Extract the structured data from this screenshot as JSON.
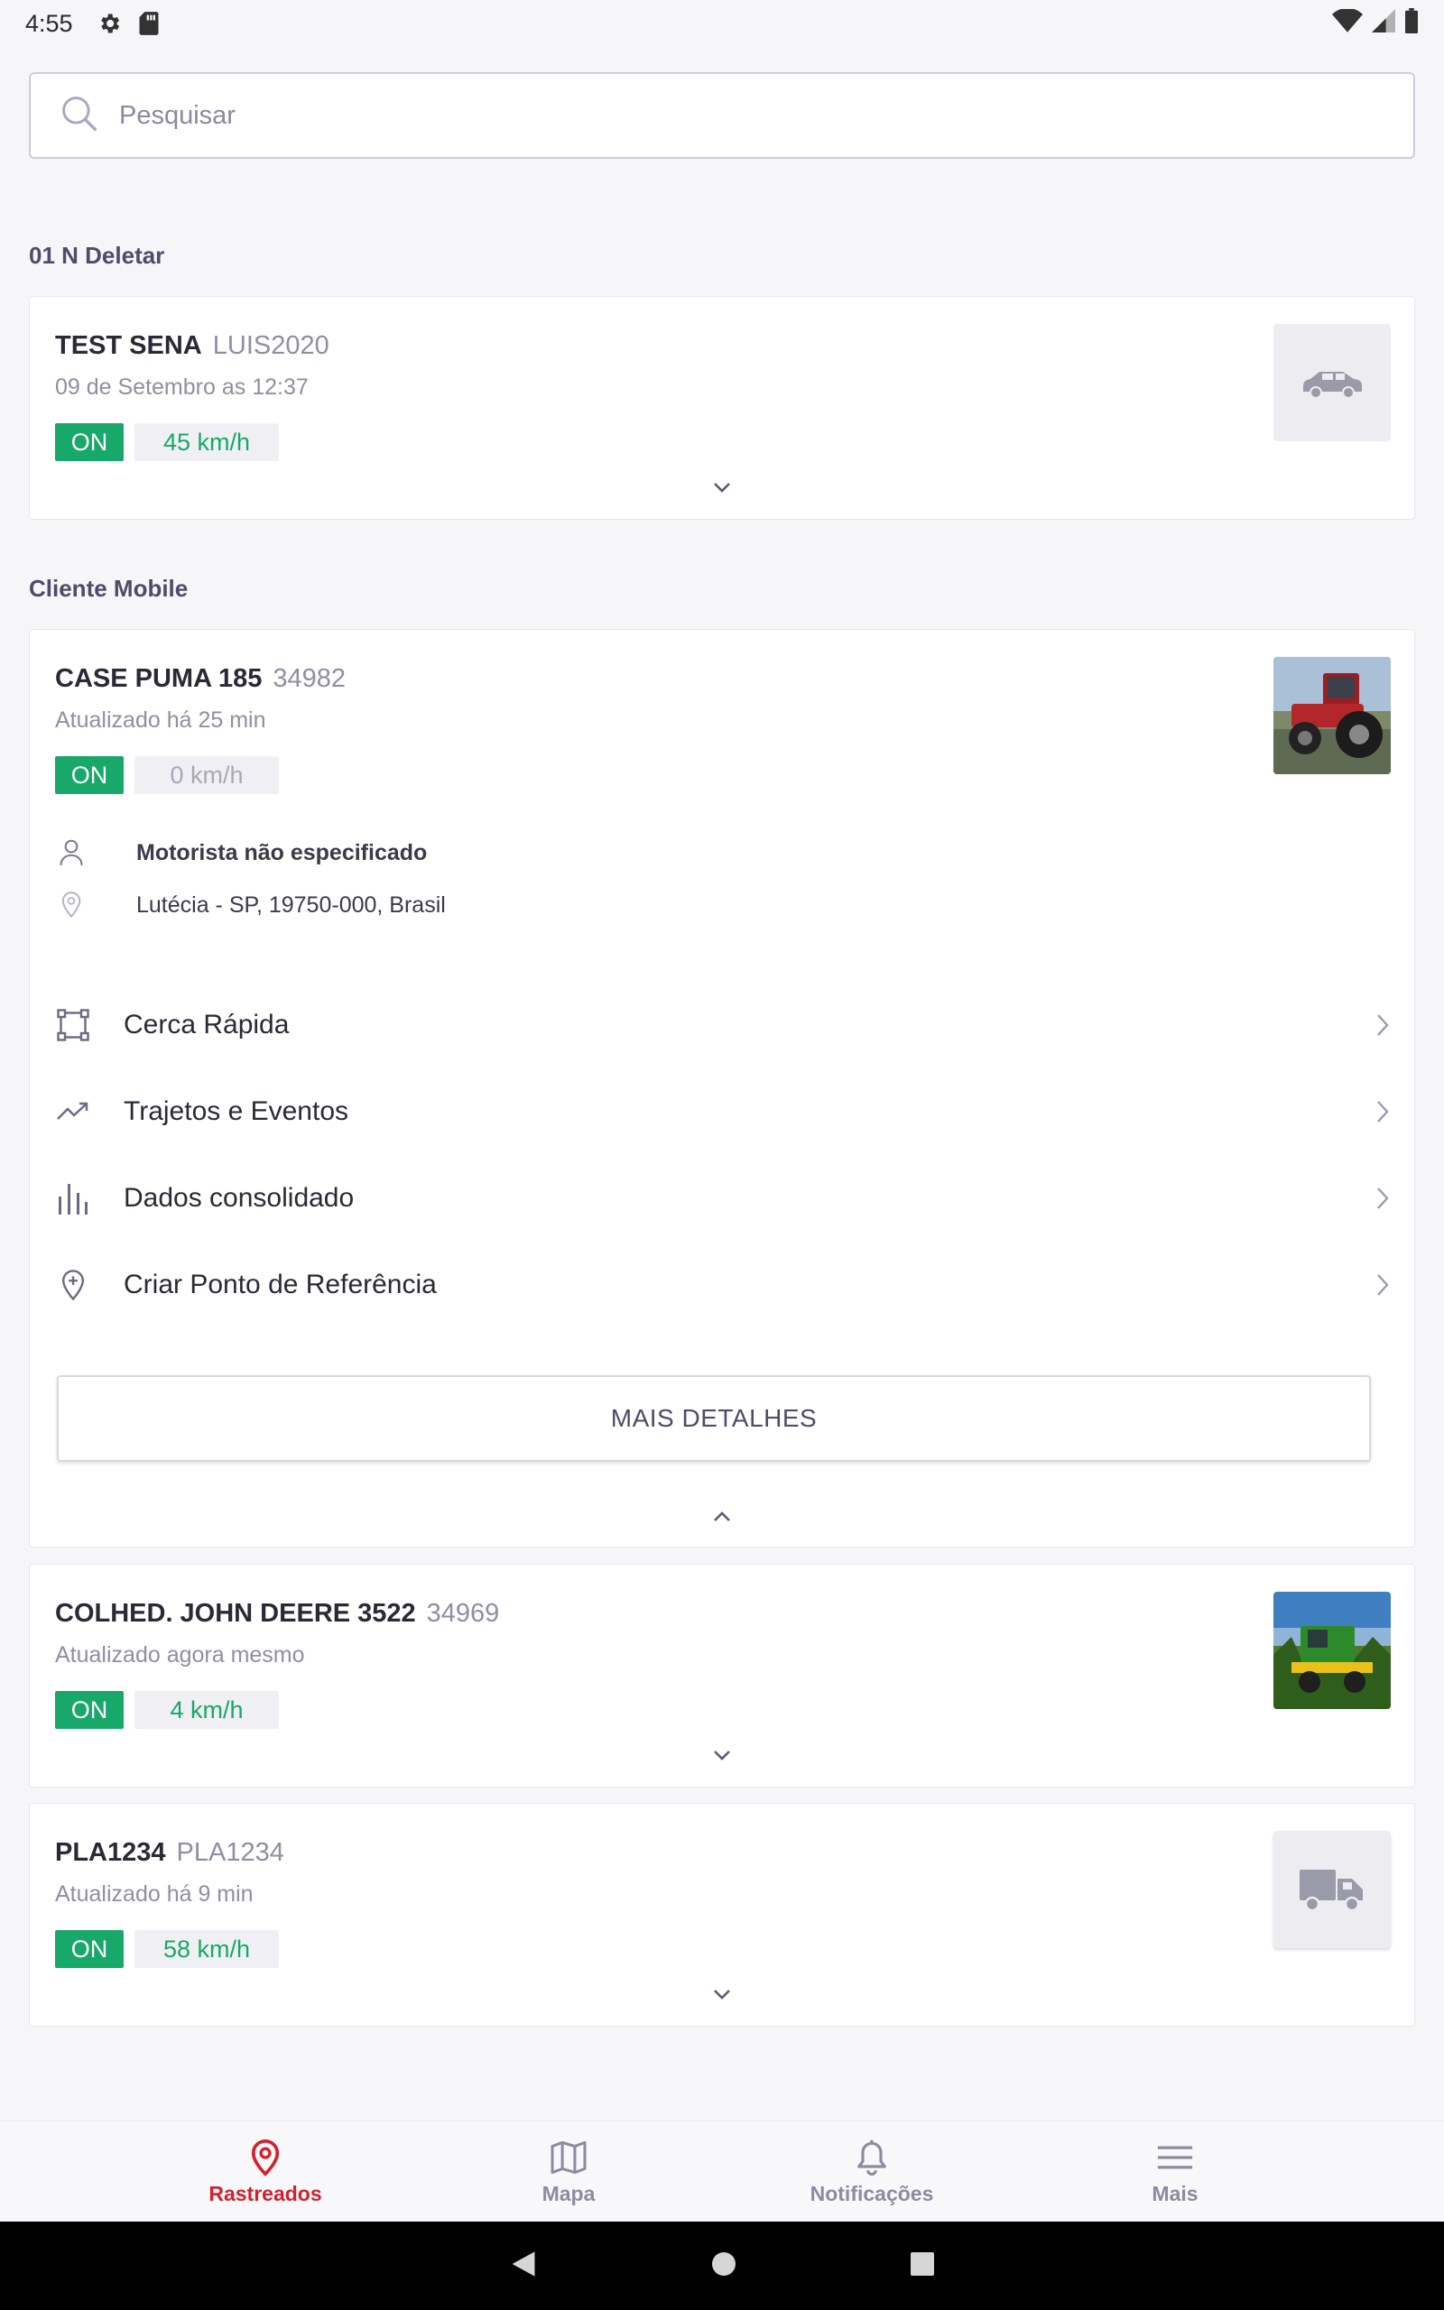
{
  "status_bar": {
    "time": "4:55"
  },
  "search": {
    "placeholder": "Pesquisar",
    "value": ""
  },
  "groups": [
    {
      "title": "01 N Deletar",
      "vehicles": [
        {
          "name": "TEST SENA",
          "plate": "LUIS2020",
          "subtitle": "09 de Setembro as 12:37",
          "status": "ON",
          "speed": "45 km/h",
          "thumb_icon": "car-icon"
        }
      ]
    },
    {
      "title": "Cliente Mobile",
      "vehicles": [
        {
          "name": "CASE PUMA 185",
          "plate": "34982",
          "subtitle": "Atualizado há 25 min",
          "status": "ON",
          "speed": "0 km/h",
          "driver": "Motorista não especificado",
          "location": "Lutécia - SP, 19750-000, Brasil",
          "actions": [
            "Cerca Rápida",
            "Trajetos e Eventos",
            "Dados consolidado",
            "Criar Ponto de Referência"
          ],
          "more_button": "MAIS DETALHES",
          "thumb_icon": "tractor-photo"
        },
        {
          "name": "COLHED. JOHN DEERE 3522",
          "plate": "34969",
          "subtitle": "Atualizado agora mesmo",
          "status": "ON",
          "speed": "4 km/h",
          "thumb_icon": "harvester-photo"
        },
        {
          "name": "PLA1234",
          "plate": "PLA1234",
          "subtitle": "Atualizado há 9 min",
          "status": "ON",
          "speed": "58 km/h",
          "thumb_icon": "truck-icon"
        }
      ]
    }
  ],
  "bottom_nav": [
    {
      "label": "Rastreados",
      "icon": "location-pin-icon",
      "active": true
    },
    {
      "label": "Mapa",
      "icon": "map-icon",
      "active": false
    },
    {
      "label": "Notificações",
      "icon": "bell-icon",
      "active": false
    },
    {
      "label": "Mais",
      "icon": "menu-icon",
      "active": false
    }
  ],
  "colors": {
    "accent": "#d4202e",
    "on_badge": "#17a86a",
    "speed_text": "#17a86a",
    "header_text": "#4e4c68"
  }
}
